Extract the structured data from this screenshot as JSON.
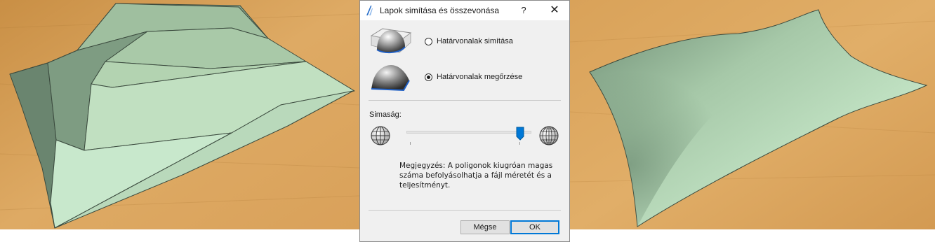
{
  "dialog": {
    "title": "Lapok simítása és összevonása",
    "help_label": "?",
    "close_label": "✕",
    "options": {
      "smooth_edges": "Határvonalak simítása",
      "preserve_edges": "Határvonalak megőrzése",
      "selected": "preserve_edges"
    },
    "smoothness_label": "Simaság:",
    "smoothness_value": 0.95,
    "note": "Megjegyzés: A poligonok kiugróan magas száma befolyásolhatja a fájl méretét és a teljesítményt.",
    "buttons": {
      "cancel": "Mégse",
      "ok": "OK"
    }
  },
  "colors": {
    "accent": "#0078d7",
    "floor": "#d7a35c",
    "surface_light": "#c8e8cc",
    "surface_dark": "#7d9a83"
  },
  "icons": {
    "app": "archicad-icon",
    "thumb_smooth": "smoothed-dome-thumbnail",
    "thumb_preserve": "preserved-edge-dome-thumbnail",
    "low_detail": "low-detail-globe-icon",
    "high_detail": "high-detail-globe-icon"
  }
}
